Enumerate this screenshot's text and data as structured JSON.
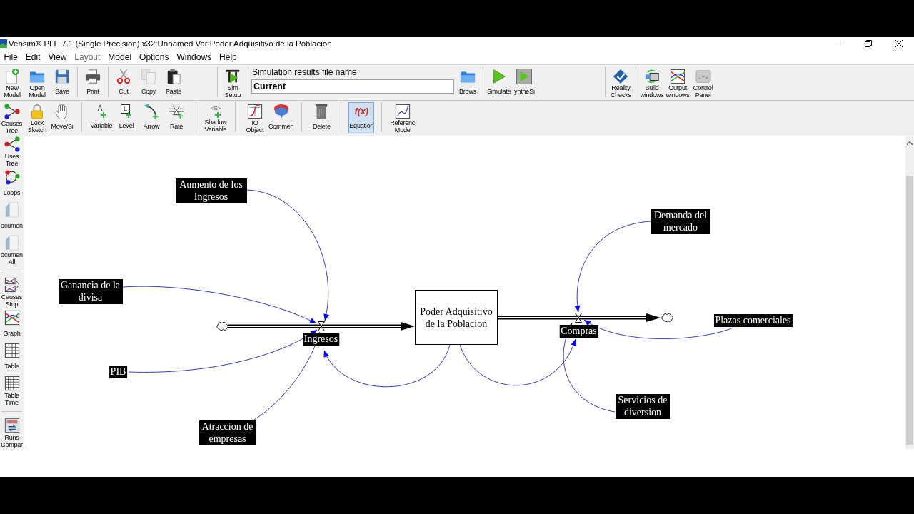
{
  "window": {
    "title": "Vensim® PLE 7.1 (Single Precision) x32:Unnamed Var:Poder Adquisitivo de la Poblacion"
  },
  "menu": [
    {
      "label": "File",
      "disabled": false
    },
    {
      "label": "Edit",
      "disabled": false
    },
    {
      "label": "View",
      "disabled": false
    },
    {
      "label": "Layout",
      "disabled": true
    },
    {
      "label": "Model",
      "disabled": false
    },
    {
      "label": "Options",
      "disabled": false
    },
    {
      "label": "Windows",
      "disabled": false
    },
    {
      "label": "Help",
      "disabled": false
    }
  ],
  "main_toolbar": [
    [
      {
        "kind": "button",
        "label": "New Model"
      },
      {
        "kind": "button",
        "label": "Open Model"
      },
      {
        "kind": "button",
        "label": "Save"
      }
    ],
    [
      {
        "kind": "button",
        "label": "Print"
      }
    ],
    [
      {
        "kind": "button",
        "label": "Cut"
      },
      {
        "kind": "button",
        "label": "Copy"
      },
      {
        "kind": "button",
        "label": "Paste"
      }
    ],
    [
      {
        "kind": "button",
        "label": "Sim Setup"
      }
    ],
    [
      {
        "kind": "field",
        "label": "Simulation results file name",
        "value": "Current"
      },
      {
        "kind": "button",
        "label": "Brows"
      }
    ],
    [
      {
        "kind": "button",
        "label": "Simulate"
      },
      {
        "kind": "button",
        "label": "yntheSi"
      }
    ],
    [
      {
        "kind": "button",
        "label": "Reality Checks"
      }
    ],
    [
      {
        "kind": "button",
        "label": "Build windows"
      },
      {
        "kind": "button",
        "label": "Output windows"
      },
      {
        "kind": "button",
        "label": "Control Panel"
      }
    ]
  ],
  "sketch_toolbar": [
    [
      {
        "label": "Lock Sketch",
        "selected": false
      },
      {
        "label": "Move/Si",
        "selected": false
      }
    ],
    [
      {
        "label": "Variable",
        "glyph": "A",
        "selected": false
      },
      {
        "label": "Level",
        "glyph": "L",
        "selected": false
      },
      {
        "label": "Arrow",
        "selected": false
      },
      {
        "label": "Rate",
        "selected": false
      }
    ],
    [
      {
        "label": "Shadow Variable",
        "glyph": "<S>",
        "selected": false
      }
    ],
    [
      {
        "label": "IO Object",
        "selected": false
      },
      {
        "label": "Commen",
        "selected": false
      }
    ],
    [
      {
        "label": "Delete",
        "selected": false
      }
    ],
    [
      {
        "label": "Equation",
        "glyph": "f(x)",
        "selected": true
      }
    ],
    [
      {
        "label": "Referenc Mode",
        "selected": false
      }
    ]
  ],
  "analysis_toolbar": [
    [
      {
        "label": "Causes Tree"
      },
      {
        "label": "Uses Tree"
      },
      {
        "label": "Loops"
      },
      {
        "label": "ocumen"
      },
      {
        "label": "ocumen All"
      }
    ],
    [
      {
        "label": "Causes Strip"
      },
      {
        "label": "Graph"
      },
      {
        "label": "Table"
      },
      {
        "label": "Table Time"
      }
    ],
    [
      {
        "label": "Runs Compar"
      }
    ]
  ],
  "diagram": {
    "stock": {
      "label": "Poder Adquisitivo de la Poblacion"
    },
    "flows": [
      {
        "kind": "inflow",
        "label": "Ingresos",
        "stock_link": true,
        "inputs": [
          {
            "label": "Aumento de los Ingresos"
          },
          {
            "label": "Ganancia de la divisa"
          },
          {
            "label": "PIB"
          },
          {
            "label": "Atraccion de empresas"
          }
        ]
      },
      {
        "kind": "outflow",
        "label": "Compras",
        "stock_link": true,
        "inputs": [
          {
            "label": "Demanda del mercado"
          },
          {
            "label": "Plazas comerciales"
          },
          {
            "label": "Servicios de diversion"
          }
        ]
      }
    ]
  }
}
